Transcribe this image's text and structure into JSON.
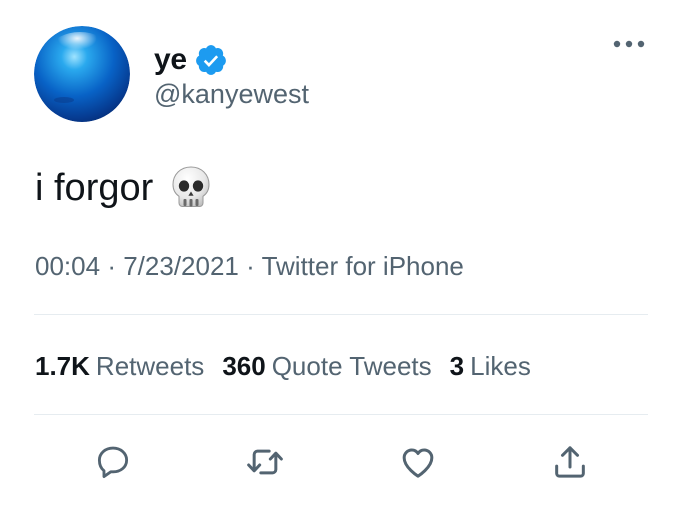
{
  "author": {
    "display_name": "ye",
    "handle": "@kanyewest",
    "verified": true,
    "avatar_icon": "blue-orb-avatar"
  },
  "tweet": {
    "text": "i forgor",
    "emoji_icon": "skull-icon",
    "time": "00:04",
    "dot1": "·",
    "date": "7/23/2021",
    "dot2": "·",
    "source": "Twitter for iPhone"
  },
  "stats": {
    "retweets_count": "1.7K",
    "retweets_label": "Retweets",
    "quotes_count": "360",
    "quotes_label": "Quote Tweets",
    "likes_count": "3",
    "likes_label": "Likes"
  },
  "actions": {
    "reply": "reply-icon",
    "retweet": "retweet-icon",
    "like": "like-icon",
    "share": "share-icon"
  },
  "colors": {
    "text_primary": "#0f1419",
    "text_secondary": "#536471",
    "verified_blue": "#1d9bf0",
    "divider": "#e6ecf0"
  }
}
